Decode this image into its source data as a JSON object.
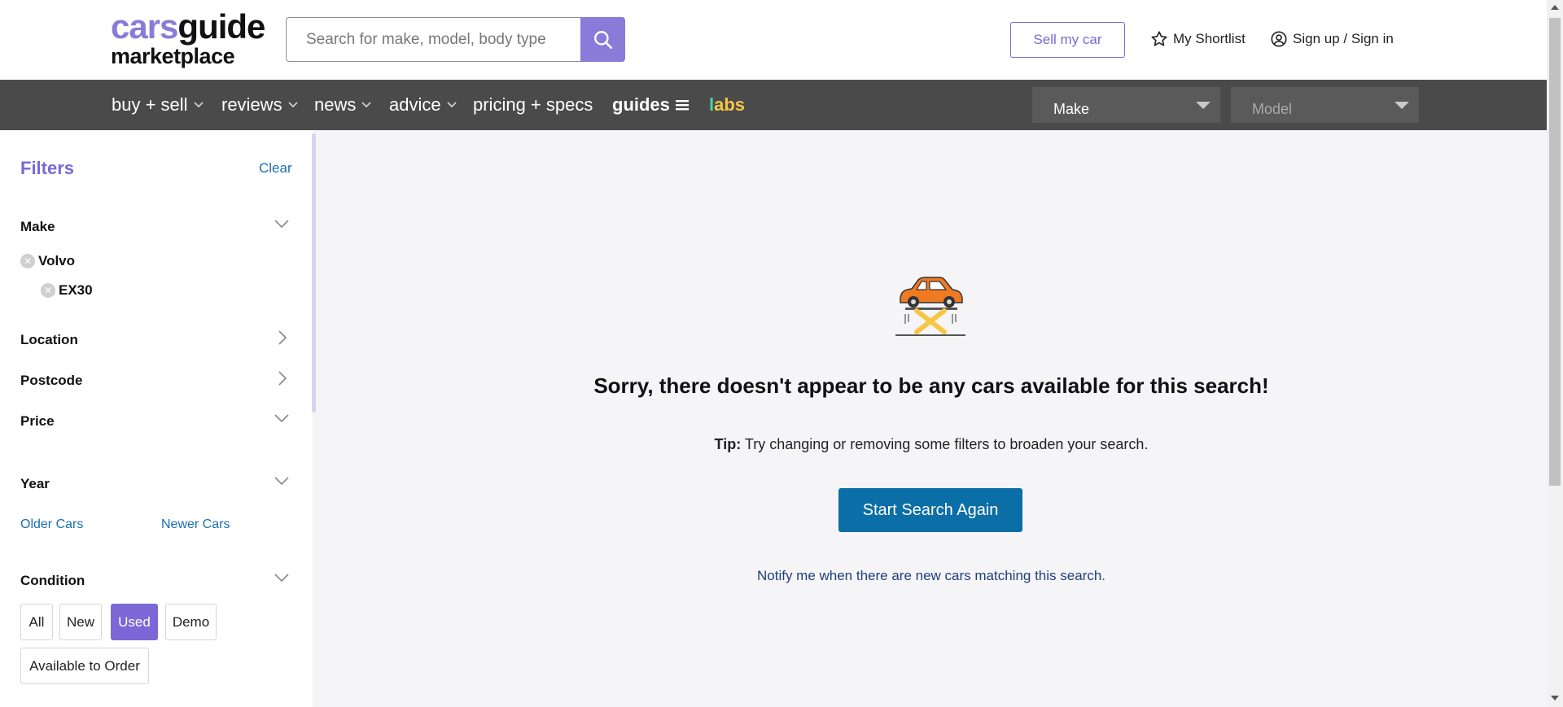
{
  "header": {
    "logo_top_cars": "cars",
    "logo_top_guide": "guide",
    "logo_bottom": "marketplace",
    "search_placeholder": "Search for make, model, body type",
    "sell_label": "Sell my car",
    "shortlist_label": "My Shortlist",
    "signin_label": "Sign up / Sign in"
  },
  "nav": {
    "items": [
      {
        "label": "buy + sell"
      },
      {
        "label": "reviews"
      },
      {
        "label": "news"
      },
      {
        "label": "advice"
      },
      {
        "label": "pricing + specs"
      },
      {
        "label": "guides"
      }
    ],
    "labs_part1": "l",
    "labs_part2": "abs",
    "make_select": "Make",
    "model_select": "Model"
  },
  "filters": {
    "title": "Filters",
    "clear": "Clear",
    "make_label": "Make",
    "make_value": "Volvo",
    "model_value": "EX30",
    "location_label": "Location",
    "postcode_label": "Postcode",
    "price_label": "Price",
    "year_label": "Year",
    "older_cars": "Older Cars",
    "newer_cars": "Newer Cars",
    "condition_label": "Condition",
    "condition_options": [
      "All",
      "New",
      "Used",
      "Demo",
      "Available to Order"
    ],
    "condition_selected": "Used"
  },
  "main": {
    "empty_title": "Sorry, there doesn't appear to be any cars available for this search!",
    "tip_label": "Tip:",
    "tip_text": " Try changing or removing some filters to broaden your search.",
    "start_button": "Start Search Again",
    "notify_link": "Notify me when there are new cars matching this search."
  },
  "colors": {
    "brand_purple": "#7b68d6",
    "nav_bg": "#4a4a4a",
    "button_blue": "#0c6ea6",
    "car_orange": "#f07a22",
    "lift_yellow": "#f6c644"
  }
}
